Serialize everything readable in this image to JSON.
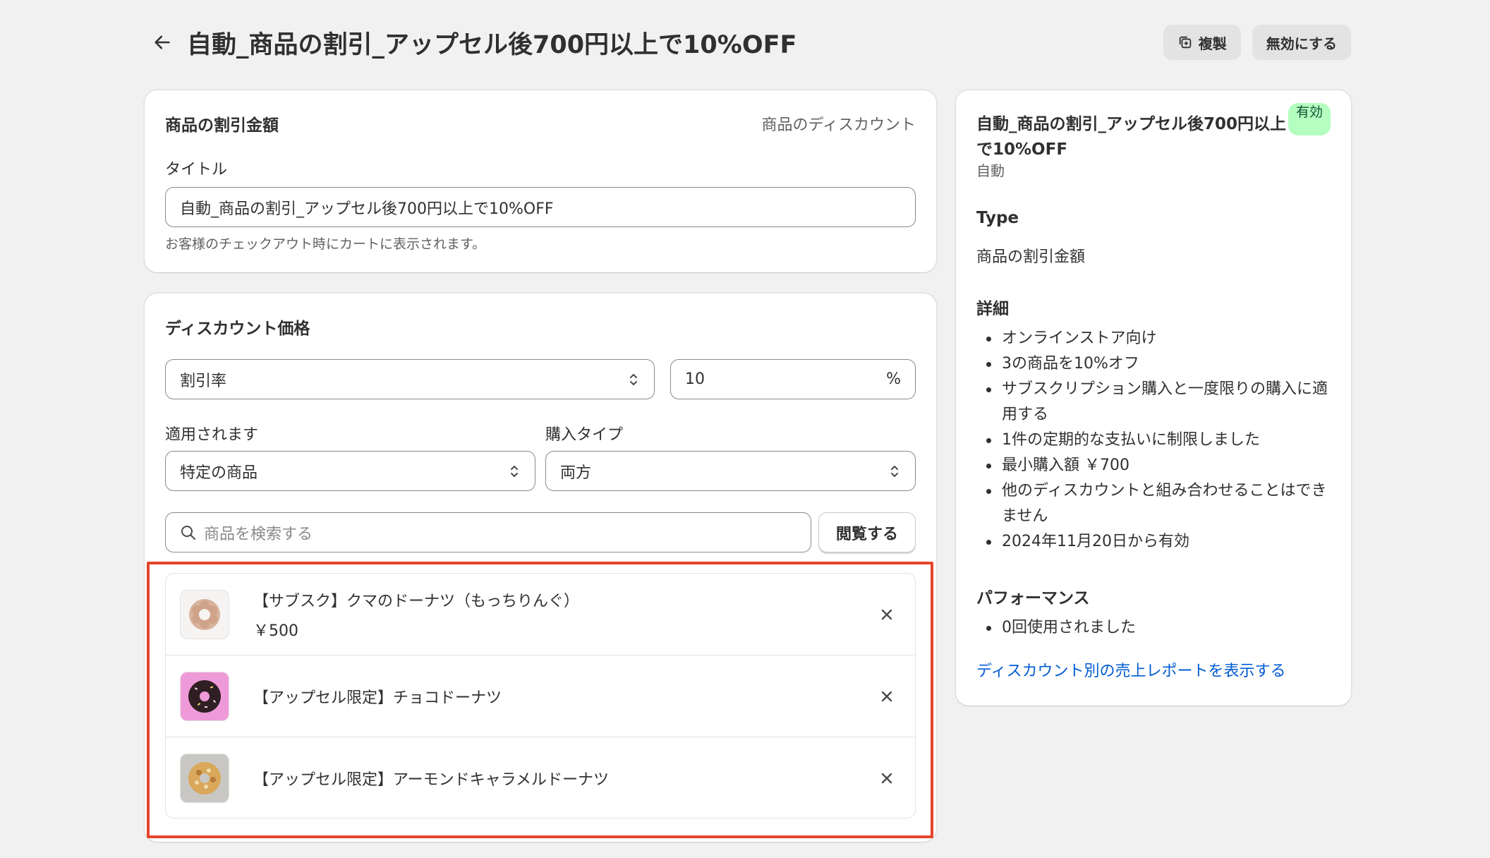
{
  "header": {
    "title": "自動_商品の割引_アップセル後700円以上で10%OFF",
    "duplicate_label": "複製",
    "deactivate_label": "無効にする"
  },
  "title_card": {
    "heading": "商品の割引金額",
    "type_label": "商品のディスカウント",
    "field_label": "タイトル",
    "field_value": "自動_商品の割引_アップセル後700円以上で10%OFF",
    "help_text": "お客様のチェックアウト時にカートに表示されます。"
  },
  "discount_card": {
    "heading": "ディスカウント価格",
    "value_type": "割引率",
    "value": "10",
    "value_suffix": "%",
    "applies_label": "適用されます",
    "applies_value": "特定の商品",
    "purchase_type_label": "購入タイプ",
    "purchase_type_value": "両方",
    "search_placeholder": "商品を検索する",
    "browse_label": "閲覧する",
    "products": [
      {
        "name": "【サブスク】クマのドーナツ（もっちりんぐ）",
        "price": "￥500"
      },
      {
        "name": "【アップセル限定】チョコドーナツ",
        "price": ""
      },
      {
        "name": "【アップセル限定】アーモンドキャラメルドーナツ",
        "price": ""
      }
    ]
  },
  "summary": {
    "title": "自動_商品の割引_アップセル後700円以上で10%OFF",
    "status_badge": "有効",
    "method": "自動",
    "type_heading": "Type",
    "type_value": "商品の割引金額",
    "details_heading": "詳細",
    "details": [
      "オンラインストア向け",
      "3の商品を10%オフ",
      "サブスクリプション購入と一度限りの購入に適用する",
      "1件の定期的な支払いに制限しました",
      "最小購入額 ￥700",
      "他のディスカウントと組み合わせることはできません",
      "2024年11月20日から有効"
    ],
    "performance_heading": "パフォーマンス",
    "performance": [
      "0回使用されました"
    ],
    "report_link": "ディスカウント別の売上レポートを表示する"
  },
  "colors": {
    "background": "#f1f1f1",
    "badge_bg": "#b4fec0",
    "link": "#005bd3",
    "highlight": "#e5452b"
  }
}
